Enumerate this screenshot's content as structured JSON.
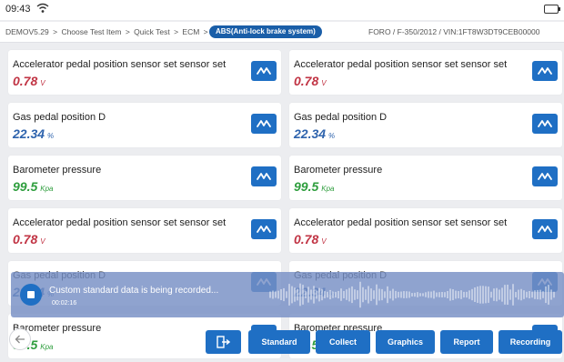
{
  "status": {
    "time": "09:43"
  },
  "breadcrumb": {
    "path": [
      "DEMOV5.29",
      ">",
      "Choose Test Item",
      ">",
      "Quick Test",
      ">",
      "ECM",
      ">"
    ],
    "current": "ABS(Anti-lock brake system)",
    "vehicle": "FORO / F-350/2012 / VIN:1FT8W3DT9CEB00000"
  },
  "colors": {
    "accent": "#1f6fc4",
    "value_red": "#c13545",
    "value_blue": "#2e63ad",
    "value_green": "#2f9e3e"
  },
  "cards": [
    {
      "label": "Accelerator pedal position sensor set sensor set",
      "value": "0.78",
      "unit": "V",
      "color": "red"
    },
    {
      "label": "Accelerator pedal position sensor set sensor set",
      "value": "0.78",
      "unit": "V",
      "color": "red"
    },
    {
      "label": "Gas pedal position D",
      "value": "22.34",
      "unit": "%",
      "color": "blue"
    },
    {
      "label": "Gas pedal position D",
      "value": "22.34",
      "unit": "%",
      "color": "blue"
    },
    {
      "label": "Barometer pressure",
      "value": "99.5",
      "unit": "Kpa",
      "color": "green"
    },
    {
      "label": "Barometer pressure",
      "value": "99.5",
      "unit": "Kpa",
      "color": "green"
    },
    {
      "label": "Accelerator pedal position sensor set sensor set",
      "value": "0.78",
      "unit": "V",
      "color": "red"
    },
    {
      "label": "Accelerator pedal position sensor set sensor set",
      "value": "0.78",
      "unit": "V",
      "color": "red"
    },
    {
      "label": "Gas pedal position D",
      "value": "22.34",
      "unit": "%",
      "color": "blue"
    },
    {
      "label": "Gas pedal position D",
      "value": "22.34",
      "unit": "%",
      "color": "blue"
    },
    {
      "label": "Barometer pressure",
      "value": "99.5",
      "unit": "Kpa",
      "color": "green"
    },
    {
      "label": "Barometer pressure",
      "value": "99.5",
      "unit": "Kpa",
      "color": "green"
    }
  ],
  "recording": {
    "message": "Custom standard data is being recorded...",
    "elapsed": "00:02:16"
  },
  "toolbar": {
    "buttons": [
      "Standard",
      "Collect",
      "Graphics",
      "Report",
      "Recording"
    ]
  },
  "icons": {
    "graph": "graph-wave-icon",
    "exit": "exit-door-icon",
    "back": "back-arrow-icon",
    "stop": "stop-icon",
    "wifi": "wifi-icon",
    "battery": "battery-icon"
  }
}
